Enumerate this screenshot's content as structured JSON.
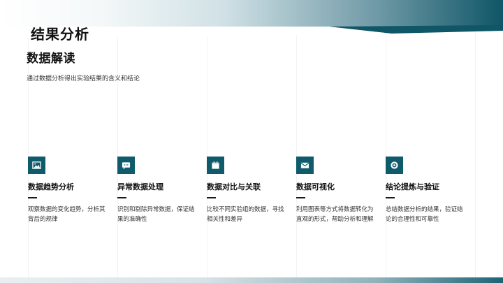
{
  "slide": {
    "title": "结果分析",
    "subtitle": "数据解读",
    "description": "通过数据分析得出实验结果的含义和结论"
  },
  "cards": [
    {
      "icon": "image-icon",
      "title": "数据趋势分析",
      "desc": "观察数据的变化趋势，分析其背后的规律"
    },
    {
      "icon": "message-icon",
      "title": "异常数据处理",
      "desc": "识别和剔除异常数据，保证结果的准确性"
    },
    {
      "icon": "calendar-icon",
      "title": "数据对比与关联",
      "desc": "比较不同实验组的数据，寻找相关性和差异"
    },
    {
      "icon": "envelope-icon",
      "title": "数据可视化",
      "desc": "利用图表等方式将数据转化为直观的形式，帮助分析和理解"
    },
    {
      "icon": "target-icon",
      "title": "结论提炼与验证",
      "desc": "总结数据分析的结果，验证结论的合理性和可靠性"
    }
  ],
  "colors": {
    "accent": "#0f5b6c",
    "band_dark": "#0f5667",
    "text": "#111111"
  }
}
